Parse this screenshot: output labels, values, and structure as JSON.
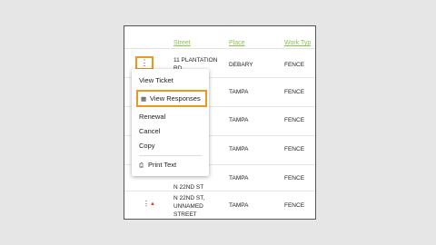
{
  "table": {
    "headers": [
      "Street",
      "Place",
      "Work Typ"
    ],
    "rows": [
      {
        "street": "11 PLANTATION\nRD",
        "place": "DEBARY",
        "work": "FENCE"
      },
      {
        "street": "",
        "place": "TAMPA",
        "work": "FENCE"
      },
      {
        "street": "",
        "place": "TAMPA",
        "work": "FENCE"
      },
      {
        "street": "",
        "place": "TAMPA",
        "work": "FENCE"
      },
      {
        "street": "N 22ND ST",
        "place": "TAMPA",
        "work": "FENCE"
      },
      {
        "street": "N 22ND ST,\nUNNAMED\nSTREET",
        "place": "TAMPA",
        "work": "FENCE"
      }
    ]
  },
  "menu": {
    "items": [
      {
        "label": "View Ticket",
        "icon": ""
      },
      {
        "label": "View Responses",
        "icon": "document-icon"
      },
      {
        "label": "Renewal",
        "icon": ""
      },
      {
        "label": "Cancel",
        "icon": ""
      },
      {
        "label": "Copy",
        "icon": ""
      },
      {
        "label": "Print Text",
        "icon": "printer-icon"
      }
    ]
  },
  "icons": {
    "kebab": "kebab-menu-icon",
    "expand": "caret-up-icon"
  },
  "colors": {
    "header_link": "#8bc34a",
    "highlight": "#f0961e",
    "caret": "#e53935"
  }
}
